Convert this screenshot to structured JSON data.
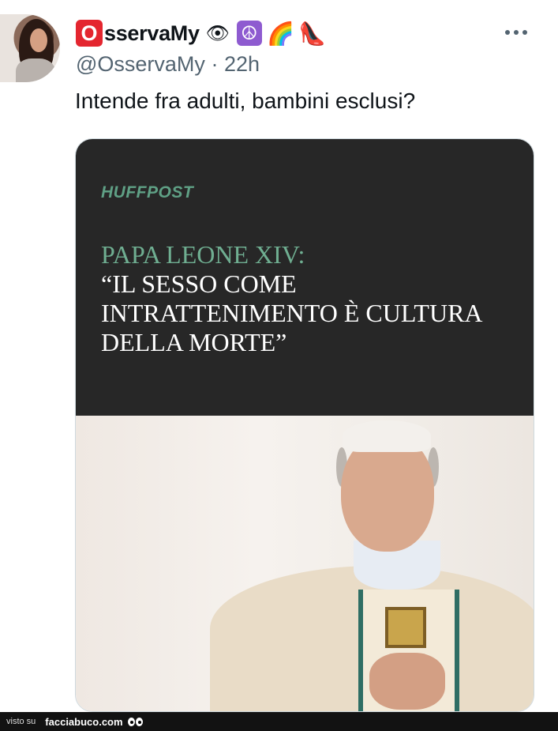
{
  "tweet": {
    "display_name": "sservaMy",
    "name_badge_letter": "O",
    "name_emojis": [
      "👁",
      "☮",
      "🌈",
      "👠"
    ],
    "handle": "@OsservaMy",
    "separator": "·",
    "time": "22h",
    "text": "Intende fra adulti, bambini esclusi?"
  },
  "card": {
    "publisher": "HUFFPOST",
    "headline_line1": "PAPA LEONE XIV:",
    "headline_line2": "“IL SESSO COME INTRATTENIMENTO È CULTURA DELLA MORTE”"
  },
  "footer": {
    "visto_su": "visto su",
    "site": "facciabuco.com"
  },
  "colors": {
    "badge": "#e4262f",
    "card_bg": "#272727",
    "headline_accent": "#6fae91",
    "secondary_text": "#536471"
  }
}
